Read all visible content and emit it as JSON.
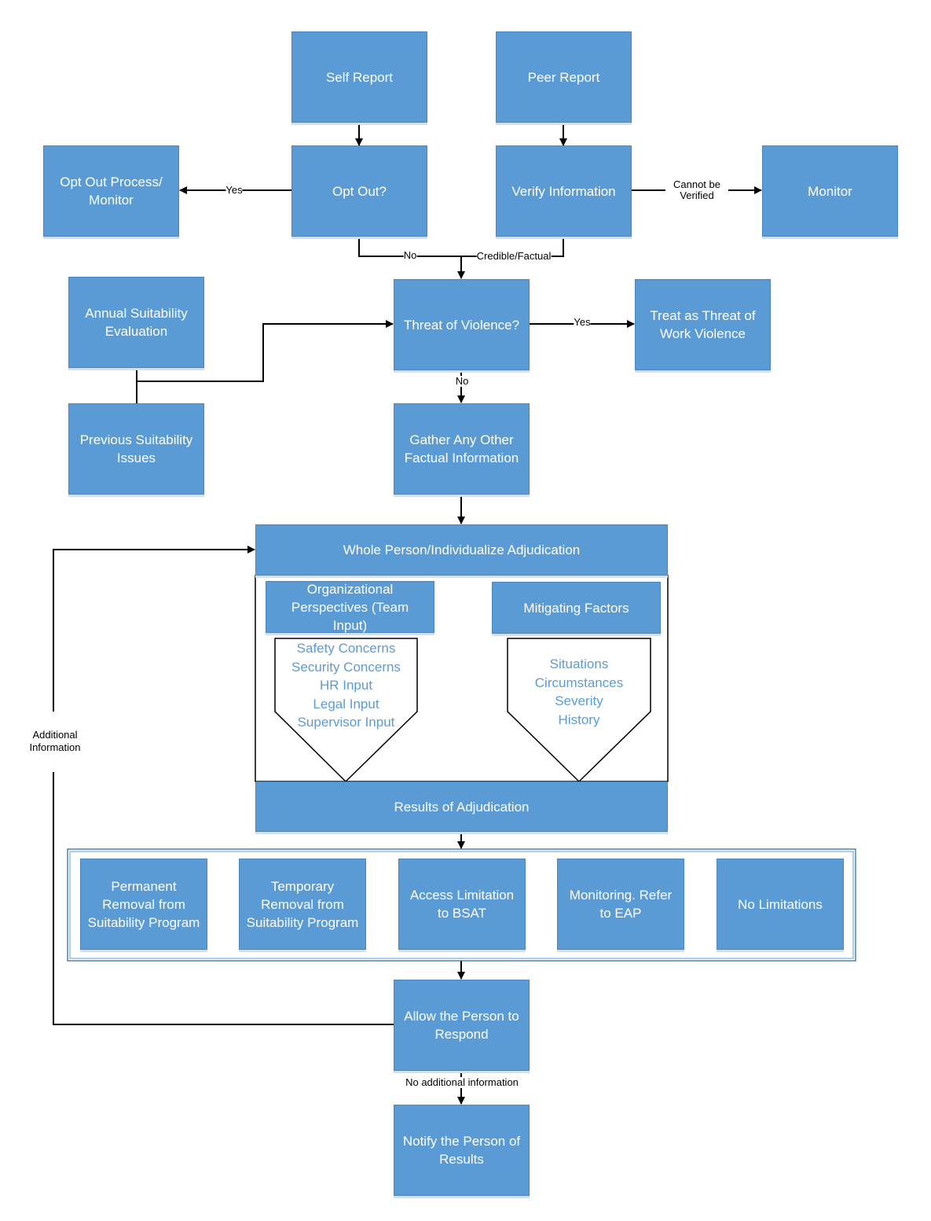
{
  "colors": {
    "box_fill": "#5B9BD5",
    "inner_text": "#5B9BD5",
    "line": "#000000"
  },
  "nodes": {
    "self_report": "Self Report",
    "peer_report": "Peer Report",
    "opt_out_process": "Opt Out Process/ Monitor",
    "opt_out": "Opt Out?",
    "verify": "Verify Information",
    "monitor": "Monitor",
    "annual": "Annual Suitability Evaluation",
    "threat": "Threat of Violence?",
    "treat": "Treat as Threat of Work Violence",
    "previous": "Previous Suitability Issues",
    "gather": "Gather Any Other Factual Information",
    "whole_person": "Whole Person/Individualize Adjudication",
    "org_perspectives": "Organizational Perspectives (Team Input)",
    "mitigating": "Mitigating Factors",
    "results": "Results of Adjudication",
    "allow": "Allow the Person to Respond",
    "notify": "Notify the Person of Results"
  },
  "org_items": [
    "Safety Concerns",
    "Security Concerns",
    "HR Input",
    "Legal Input",
    "Supervisor Input"
  ],
  "mitigating_items": [
    "Situations",
    "Circumstances",
    "Severity",
    "History"
  ],
  "outcomes": [
    "Permanent Removal from Suitability Program",
    "Temporary Removal from Suitability Program",
    "Access Limitation to BSAT",
    "Monitoring. Refer to EAP",
    "No Limitations"
  ],
  "edge_labels": {
    "opt_yes": "Yes",
    "cannot_verify": "Cannot be Verified",
    "opt_no": "No",
    "credible": "Credible/Factual",
    "threat_yes": "Yes",
    "threat_no": "No",
    "additional": "Additional Information",
    "no_additional": "No additional information"
  }
}
